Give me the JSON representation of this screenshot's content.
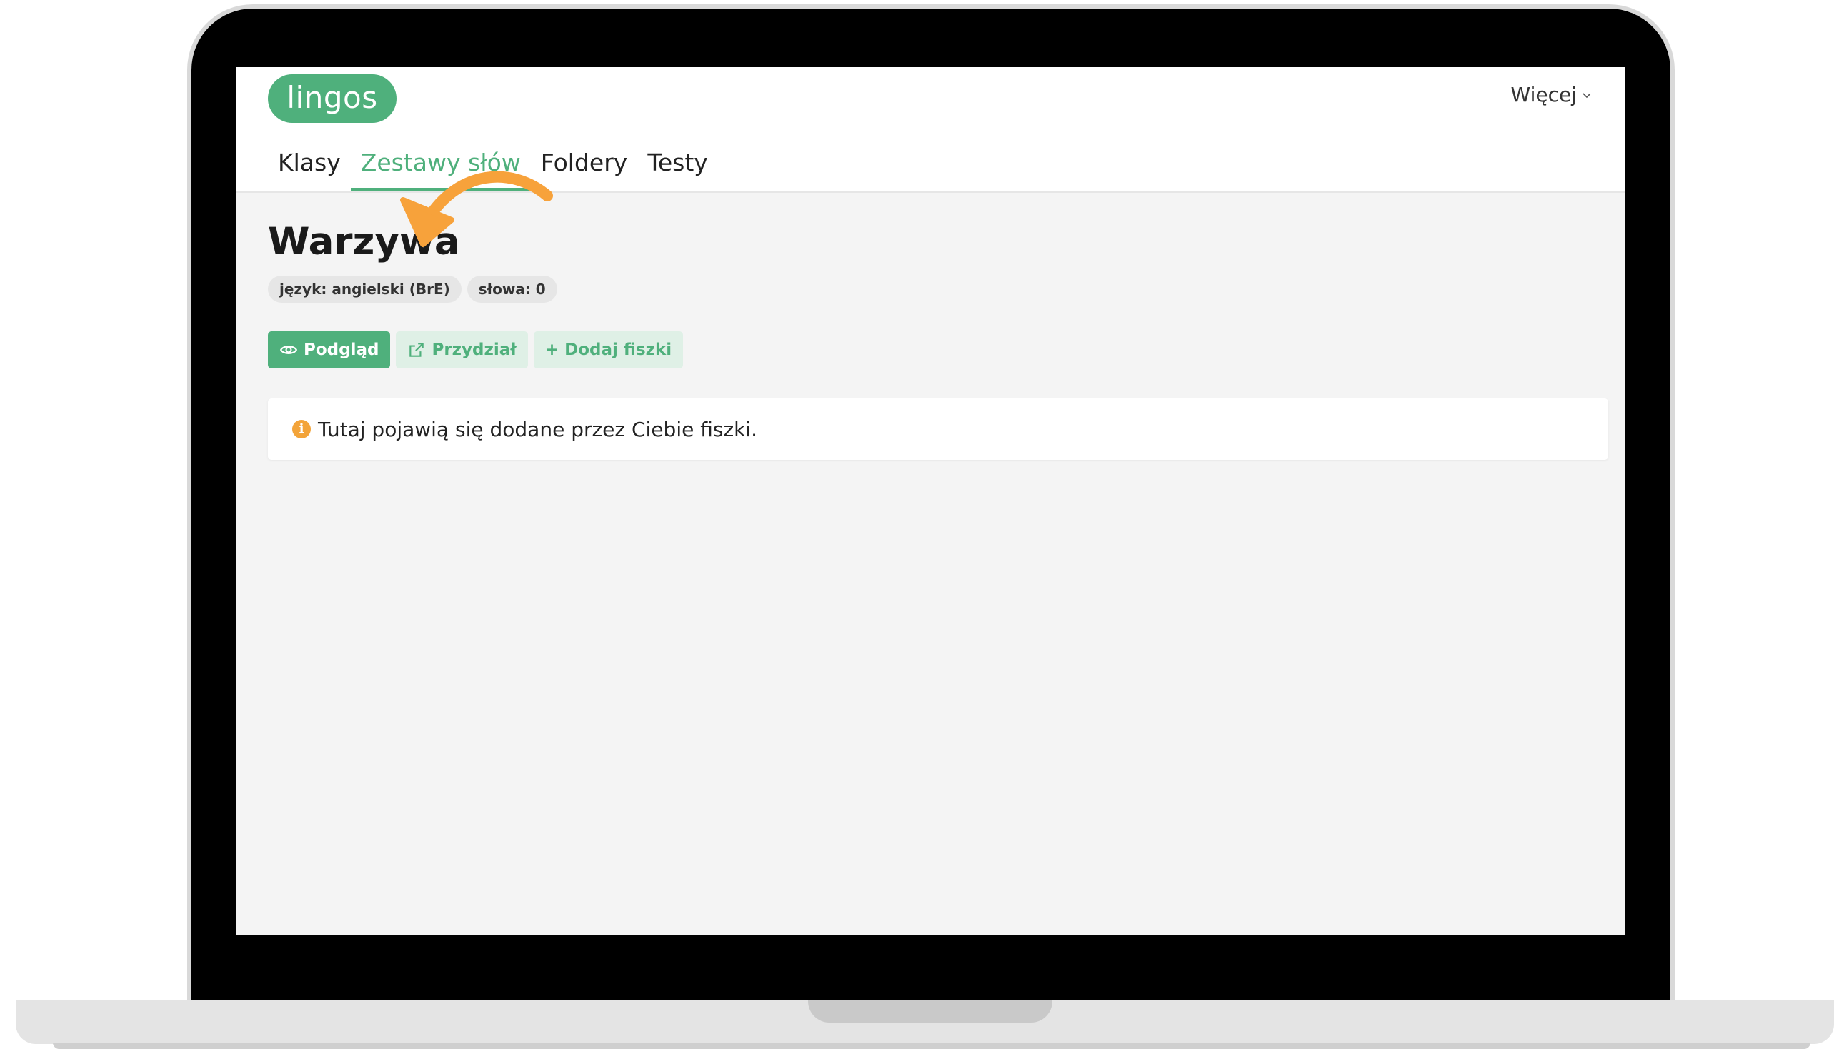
{
  "app": {
    "logo_text": "lingos",
    "more_menu_label": "Więcej"
  },
  "nav": {
    "tabs": [
      {
        "label": "Klasy",
        "active": false
      },
      {
        "label": "Zestawy słów",
        "active": true
      },
      {
        "label": "Foldery",
        "active": false
      },
      {
        "label": "Testy",
        "active": false
      }
    ]
  },
  "set": {
    "title": "Warzywa",
    "badges": {
      "language": "język: angielski (BrE)",
      "words": "słowa: 0"
    }
  },
  "actions": {
    "preview_label": "Podgląd",
    "assign_label": "Przydział",
    "add_flashcards_label": "+ Dodaj fiszki"
  },
  "info": {
    "message": "Tutaj pojawią się dodane przez Ciebie fiszki.",
    "icon_glyph": "i"
  },
  "colors": {
    "brand_green": "#4fb07c",
    "soft_green": "#dff0e6",
    "accent_orange": "#f3a43a",
    "annotation_arrow": "#f7a23b"
  },
  "icons": {
    "preview": "eye-icon",
    "assign": "share-icon",
    "more": "chevron-down-icon",
    "info": "info-icon",
    "annotation": "curved-arrow-icon"
  }
}
